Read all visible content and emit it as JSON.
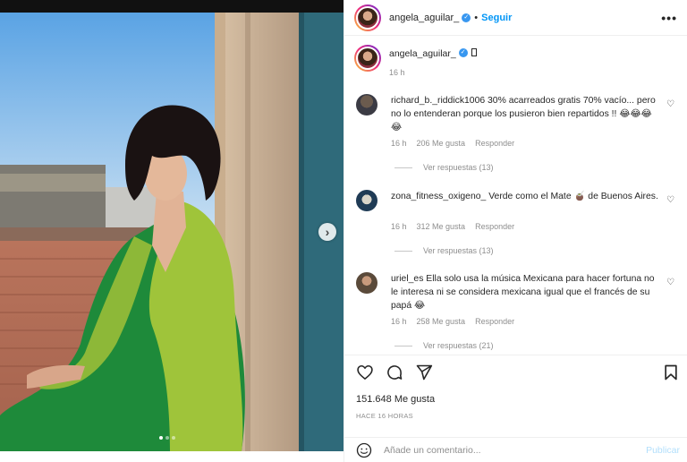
{
  "post": {
    "username": "angela_aguilar_",
    "follow_label": "Seguir",
    "separator": "•",
    "more_label": "•••",
    "caption_time": "16 h",
    "likes": "151.648 Me gusta",
    "posted_ago": "HACE 16 HORAS",
    "carousel_dots": 3,
    "next_label": "›"
  },
  "comments": [
    {
      "user": "richard_b._riddick1006",
      "text": "30% acarreados gratis 70% vacío... pero no lo entenderan porque los pusieron bien repartidos !! 😂😂😂😂",
      "time": "16 h",
      "likes": "206 Me gusta",
      "reply": "Responder",
      "replies": "Ver respuestas (13)"
    },
    {
      "user": "zona_fitness_oxigeno_",
      "text": "Verde como el Mate 🧉 de Buenos Aires.",
      "time": "16 h",
      "likes": "312 Me gusta",
      "reply": "Responder",
      "replies": "Ver respuestas (13)"
    },
    {
      "user": "uriel_es",
      "text": "Ella solo usa la música Mexicana para hacer fortuna no le interesa ni se considera mexicana igual que el francés de su papá 😂",
      "time": "16 h",
      "likes": "258 Me gusta",
      "reply": "Responder",
      "replies": "Ver respuestas (21)"
    }
  ],
  "composer": {
    "placeholder": "Añade un comentario...",
    "publish_label": "Publicar"
  },
  "icons": {
    "heart": "heart-icon",
    "comment": "comment-icon",
    "share": "send-icon",
    "save": "bookmark-icon",
    "emoji": "emoji-icon"
  },
  "colors": {
    "accent": "#0095f6",
    "verified": "#3897f0",
    "publish_disabled": "#b2dffc",
    "muted": "#8e8e8e"
  }
}
